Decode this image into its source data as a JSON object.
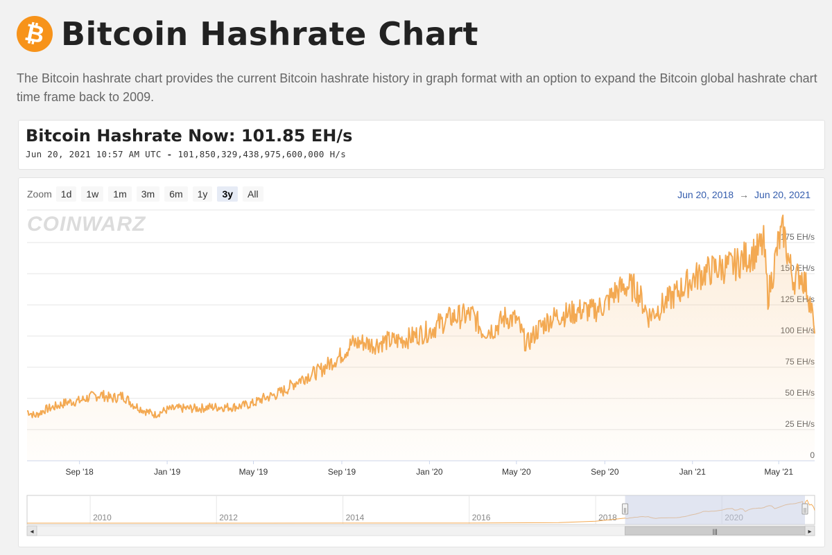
{
  "page": {
    "title": "Bitcoin Hashrate Chart",
    "logo_symbol": "₿",
    "intro": "The Bitcoin hashrate chart provides the current Bitcoin hashrate history in graph format with an option to expand the Bitcoin global hashrate chart time frame back to 2009."
  },
  "now": {
    "title": "Bitcoin Hashrate Now: 101.85 EH/s",
    "timestamp": "Jun 20, 2021 10:57 AM UTC",
    "separator": "-",
    "full_value": "101,850,329,438,975,600,000 H/s"
  },
  "zoom": {
    "label": "Zoom",
    "buttons": [
      "1d",
      "1w",
      "1m",
      "3m",
      "6m",
      "1y",
      "3y",
      "All"
    ],
    "active": "3y"
  },
  "range": {
    "from": "Jun 20, 2018",
    "arrow": "→",
    "to": "Jun 20, 2021"
  },
  "watermark": "COINWARZ",
  "colors": {
    "line": "#f3a952",
    "brand": "#f7931a",
    "range_text": "#335cad",
    "navigator_mask": "#c8cfe6"
  },
  "icons": {
    "scroll_left": "◂",
    "scroll_right": "▸",
    "handle": "||",
    "thumb": "|||"
  },
  "chart_data": {
    "type": "area",
    "title": "",
    "xlabel": "",
    "ylabel": "",
    "unit": "EH/s",
    "x_range": [
      "2018-06-20",
      "2021-06-20"
    ],
    "ylim": [
      0,
      200
    ],
    "yticks": [
      0,
      25,
      50,
      75,
      100,
      125,
      150,
      175
    ],
    "ytick_labels": [
      "0",
      "25 EH/s",
      "50 EH/s",
      "75 EH/s",
      "100 EH/s",
      "125 EH/s",
      "150 EH/s",
      "175 EH/s"
    ],
    "xticks": [
      {
        "date": "2018-09-01",
        "label": "Sep '18"
      },
      {
        "date": "2019-01-01",
        "label": "Jan '19"
      },
      {
        "date": "2019-05-01",
        "label": "May '19"
      },
      {
        "date": "2019-09-01",
        "label": "Sep '19"
      },
      {
        "date": "2020-01-01",
        "label": "Jan '20"
      },
      {
        "date": "2020-05-01",
        "label": "May '20"
      },
      {
        "date": "2020-09-01",
        "label": "Sep '20"
      },
      {
        "date": "2021-01-01",
        "label": "Jan '21"
      },
      {
        "date": "2021-05-01",
        "label": "May '21"
      }
    ],
    "grid": true,
    "legend": "none",
    "series": [
      {
        "values": [
          [
            "2018-06-20",
            40
          ],
          [
            "2018-07-01",
            36
          ],
          [
            "2018-07-15",
            41
          ],
          [
            "2018-08-01",
            44
          ],
          [
            "2018-08-15",
            47
          ],
          [
            "2018-09-01",
            48
          ],
          [
            "2018-09-15",
            51
          ],
          [
            "2018-10-01",
            53
          ],
          [
            "2018-10-15",
            50
          ],
          [
            "2018-11-01",
            52
          ],
          [
            "2018-11-15",
            45
          ],
          [
            "2018-12-01",
            40
          ],
          [
            "2018-12-15",
            37
          ],
          [
            "2019-01-01",
            41
          ],
          [
            "2019-01-15",
            42
          ],
          [
            "2019-02-01",
            42
          ],
          [
            "2019-02-15",
            42
          ],
          [
            "2019-03-01",
            43
          ],
          [
            "2019-03-15",
            43
          ],
          [
            "2019-04-01",
            43
          ],
          [
            "2019-04-15",
            44
          ],
          [
            "2019-05-01",
            46
          ],
          [
            "2019-05-15",
            50
          ],
          [
            "2019-06-01",
            53
          ],
          [
            "2019-06-15",
            57
          ],
          [
            "2019-07-01",
            64
          ],
          [
            "2019-07-15",
            68
          ],
          [
            "2019-08-01",
            72
          ],
          [
            "2019-08-15",
            78
          ],
          [
            "2019-09-01",
            85
          ],
          [
            "2019-09-15",
            94
          ],
          [
            "2019-10-01",
            95
          ],
          [
            "2019-10-15",
            93
          ],
          [
            "2019-11-01",
            96
          ],
          [
            "2019-11-15",
            96
          ],
          [
            "2019-12-01",
            98
          ],
          [
            "2019-12-15",
            101
          ],
          [
            "2020-01-01",
            104
          ],
          [
            "2020-01-15",
            110
          ],
          [
            "2020-02-01",
            115
          ],
          [
            "2020-02-15",
            116
          ],
          [
            "2020-03-01",
            117
          ],
          [
            "2020-03-15",
            104
          ],
          [
            "2020-04-01",
            106
          ],
          [
            "2020-04-15",
            115
          ],
          [
            "2020-05-01",
            113
          ],
          [
            "2020-05-15",
            93
          ],
          [
            "2020-06-01",
            106
          ],
          [
            "2020-06-15",
            113
          ],
          [
            "2020-07-01",
            117
          ],
          [
            "2020-07-15",
            118
          ],
          [
            "2020-08-01",
            121
          ],
          [
            "2020-08-15",
            120
          ],
          [
            "2020-09-01",
            125
          ],
          [
            "2020-09-15",
            135
          ],
          [
            "2020-10-01",
            140
          ],
          [
            "2020-10-15",
            138
          ],
          [
            "2020-11-01",
            116
          ],
          [
            "2020-11-15",
            122
          ],
          [
            "2020-12-01",
            130
          ],
          [
            "2020-12-15",
            137
          ],
          [
            "2021-01-01",
            146
          ],
          [
            "2021-01-15",
            150
          ],
          [
            "2021-02-01",
            154
          ],
          [
            "2021-02-15",
            155
          ],
          [
            "2021-03-01",
            157
          ],
          [
            "2021-03-15",
            163
          ],
          [
            "2021-04-01",
            168
          ],
          [
            "2021-04-10",
            174
          ],
          [
            "2021-04-16",
            132
          ],
          [
            "2021-04-22",
            148
          ],
          [
            "2021-05-01",
            176
          ],
          [
            "2021-05-08",
            184
          ],
          [
            "2021-05-15",
            160
          ],
          [
            "2021-05-22",
            145
          ],
          [
            "2021-06-01",
            150
          ],
          [
            "2021-06-10",
            137
          ],
          [
            "2021-06-16",
            120
          ],
          [
            "2021-06-20",
            102
          ]
        ]
      }
    ],
    "navigator": {
      "x_range": [
        "2009-01-01",
        "2021-06-20"
      ],
      "tick_labels": [
        "2010",
        "2012",
        "2014",
        "2016",
        "2018",
        "2020"
      ],
      "selection": [
        "2018-06-20",
        "2021-06-20"
      ]
    }
  }
}
